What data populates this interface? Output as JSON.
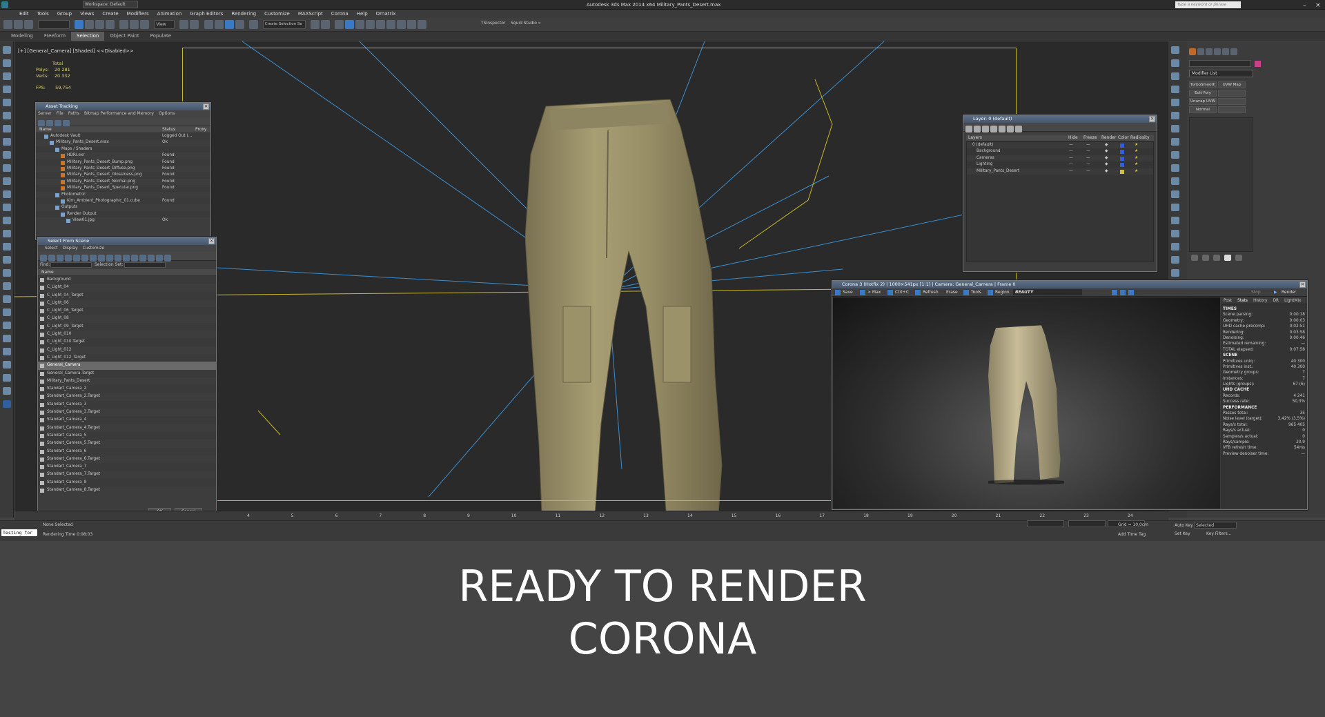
{
  "app": {
    "workspace": "Workspace: Default",
    "title": "Autodesk 3ds Max  2014 x64     Military_Pants_Desert.max",
    "search_placeholder": "Type a keyword or phrase"
  },
  "menu": [
    "Edit",
    "Tools",
    "Group",
    "Views",
    "Create",
    "Modifiers",
    "Animation",
    "Graph Editors",
    "Rendering",
    "Customize",
    "MAXScript",
    "Corona",
    "Help",
    "Ornatrix"
  ],
  "toolbar": {
    "view_dropdown": "View",
    "selection_set": "Create Selection Se",
    "ts_inspector": "TSInspector",
    "squid": "Squid Studio »"
  },
  "ribbon": {
    "tabs": [
      "Modeling",
      "Freeform",
      "Selection",
      "Object Paint",
      "Populate"
    ],
    "active": "Selection"
  },
  "viewport": {
    "label": "[+] [General_Camera] [Shaded]  <<Disabled>>",
    "stats": {
      "total": "Total",
      "polys_label": "Polys:",
      "polys": "20 281",
      "verts_label": "Verts:",
      "verts": "20 332",
      "fps_label": "FPS:",
      "fps": "59,754"
    }
  },
  "asset_tracking": {
    "title": "Asset Tracking",
    "menu": [
      "Server",
      "File",
      "Paths",
      "Bitmap Performance and Memory",
      "Options"
    ],
    "columns": [
      "Name",
      "Status",
      "Proxy R"
    ],
    "rows": [
      {
        "name": "Autodesk Vault",
        "status": "Logged Out (..."
      },
      {
        "name": "Military_Pants_Desert.max",
        "status": "Ok"
      },
      {
        "name": "Maps / Shaders",
        "status": ""
      },
      {
        "name": "HDRI.exr",
        "status": "Found"
      },
      {
        "name": "Military_Pants_Desert_Bump.png",
        "status": "Found"
      },
      {
        "name": "Military_Pants_Desert_Diffuse.png",
        "status": "Found"
      },
      {
        "name": "Military_Pants_Desert_Glossiness.png",
        "status": "Found"
      },
      {
        "name": "Military_Pants_Desert_Normal.png",
        "status": "Found"
      },
      {
        "name": "Military_Pants_Desert_Specular.png",
        "status": "Found"
      },
      {
        "name": "Photometric",
        "status": ""
      },
      {
        "name": "Kim_Ambient_Photographic_01.cube",
        "status": "Found"
      },
      {
        "name": "Outputs",
        "status": ""
      },
      {
        "name": "Render Output",
        "status": ""
      },
      {
        "name": "View01.jpg",
        "status": "Ok"
      }
    ]
  },
  "select_from_scene": {
    "title": "Select From Scene",
    "menu": [
      "Select",
      "Display",
      "Customize"
    ],
    "find_label": "Find:",
    "selection_set_label": "Selection Set:",
    "column": "Name",
    "rows": [
      "Background",
      "C_Light_04",
      "C_Light_04_Target",
      "C_Light_06",
      "C_Light_06_Target",
      "C_Light_08",
      "C_Light_09_Target",
      "C_Light_010",
      "C_Light_010.Target",
      "C_Light_012",
      "C_Light_012_Target",
      "General_Camera",
      "General_Camera.Target",
      "Military_Pants_Desert",
      "Standart_Camera_2",
      "Standart_Camera_2.Target",
      "Standart_Camera_3",
      "Standart_Camera_3.Target",
      "Standart_Camera_4",
      "Standart_Camera_4.Target",
      "Standart_Camera_5",
      "Standart_Camera_5.Target",
      "Standart_Camera_6",
      "Standart_Camera_6.Target",
      "Standart_Camera_7",
      "Standart_Camera_7.Target",
      "Standart_Camera_8",
      "Standart_Camera_8.Target"
    ],
    "selected": "General_Camera",
    "ok": "OK",
    "cancel": "Cancel"
  },
  "layers": {
    "title": "Layer: 0 (default)",
    "columns": [
      "Layers",
      "Hide",
      "Freeze",
      "Render",
      "Color",
      "Radiosity"
    ],
    "rows": [
      "0 (default)",
      "Background",
      "Cameras",
      "Lighting",
      "Military_Pants_Desert"
    ],
    "layer_colors": [
      "#3a5bd8",
      "#3a5bd8",
      "#3a5bd8",
      "#3a5bd8",
      "#c8c24a"
    ]
  },
  "command_panel": {
    "modifier_list": "Modifier List",
    "buttons": [
      "TurboSmooth",
      "UVW Map",
      "Edit Poly",
      "Unwrap UVW",
      "Normal"
    ]
  },
  "corona": {
    "title": "Corona 3 (Hotfix 2) | 1000×541px [1:1] | Camera: General_Camera | Frame 0",
    "toolbar": {
      "save": "Save",
      "max": "> Max",
      "copy": "Ctrl+C",
      "refresh": "Refresh",
      "erase": "Erase",
      "tools": "Tools",
      "region": "Region",
      "pass": "BEAUTY",
      "stop": "Stop",
      "render": "Render"
    },
    "tabs": [
      "Post",
      "Stats",
      "History",
      "DR",
      "LightMix"
    ],
    "stats": [
      {
        "h": "TIMES"
      },
      {
        "k": "Scene parsing:",
        "v": "0:00:18"
      },
      {
        "k": "Geometry:",
        "v": "0:00:03"
      },
      {
        "k": "UHD cache precomp:",
        "v": "0:02:51"
      },
      {
        "k": "Rendering:",
        "v": "0:03:58"
      },
      {
        "k": "Denoising:",
        "v": "0:00:46"
      },
      {
        "k": "Estimated remaining:",
        "v": "—"
      },
      {
        "k": "TOTAL elapsed:",
        "v": "0:07:58"
      },
      {
        "h": "SCENE"
      },
      {
        "k": "Primitives uniq.:",
        "v": "40 300"
      },
      {
        "k": "Primitives inst.:",
        "v": "40 300"
      },
      {
        "k": "Geometry groups:",
        "v": "7"
      },
      {
        "k": "Instances:",
        "v": "7"
      },
      {
        "k": "Lights (groups):",
        "v": "67 (6)"
      },
      {
        "h": "UHD CACHE"
      },
      {
        "k": "Records:",
        "v": "4 241"
      },
      {
        "k": "Success rate:",
        "v": "50,3%"
      },
      {
        "h": "PERFORMANCE"
      },
      {
        "k": "Passes total:",
        "v": "35"
      },
      {
        "k": "Noise level (target):",
        "v": "3,42% (3,5%)"
      },
      {
        "k": "Rays/s total:",
        "v": "965 405"
      },
      {
        "k": "Rays/s actual:",
        "v": "0"
      },
      {
        "k": "Samples/s actual:",
        "v": "0"
      },
      {
        "k": "Rays/sample:",
        "v": "20,9"
      },
      {
        "k": "VFB refresh time:",
        "v": "54ms"
      },
      {
        "k": "Preview denoiser time:",
        "v": "—"
      }
    ]
  },
  "timeline": {
    "ticks": [
      "4",
      "5",
      "6",
      "7",
      "8",
      "9",
      "10",
      "11",
      "12",
      "13",
      "14",
      "15",
      "16",
      "17",
      "18",
      "19",
      "20",
      "21",
      "22",
      "23",
      "24"
    ]
  },
  "status": {
    "maxscript": "Testing for",
    "none_selected": "None Selected",
    "rendering_time": "Rendering Time  0:08:03",
    "grid": "Grid = 10,0cm",
    "add_time_tag": "Add Time Tag",
    "auto_key": "Auto Key",
    "set_key": "Set Key",
    "selected": "Selected",
    "key_filters": "Key Filters..."
  },
  "caption": {
    "line1": "READY TO RENDER",
    "line2": "CORONA"
  },
  "colors": {
    "accent": "#3a79c4",
    "camera_frame": "#c9b82a",
    "pants": "#a89e74",
    "viewport_bg": "#2a2a2a"
  }
}
